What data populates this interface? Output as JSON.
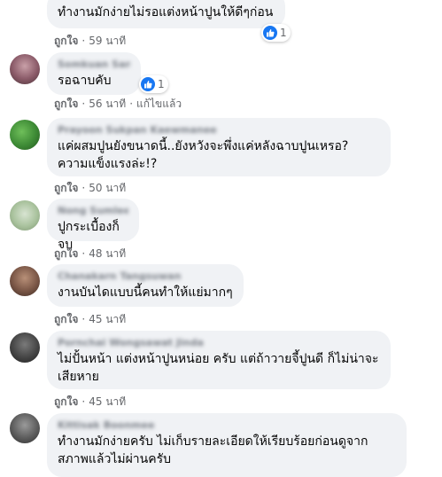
{
  "colors": {
    "like_blue": "#1877f2",
    "bubble_bg": "#f0f2f5",
    "meta_text": "#65676b"
  },
  "actions": {
    "like": "ถูกใจ",
    "dot": "·",
    "edited": "แก้ไขแล้ว"
  },
  "comments": [
    {
      "author": "",
      "text": "ทำงานมักง่ายไม่รอแต่งหน้าปูนให้ดีๆก่อน",
      "time": "59 นาที",
      "reactions": "1"
    },
    {
      "author": "Somkuan Sangkhawet",
      "text": "รอฉาบคับ",
      "time": "56 นาที",
      "reactions": "1"
    },
    {
      "author": "Prayoon Sukpan Kaewmanee",
      "text": "แค่ผสมปูนยังขนาดนี้..ยังหวังจะพึ่งแค่หลังฉาบปูนเหรอ? ความแข็งแรงล่ะ!?",
      "time": "50 นาที"
    },
    {
      "author": "Nong Sumlee",
      "text": "ปูกระเบื้องก็จบ",
      "time": "48 นาที"
    },
    {
      "author": "Chanakarn Tangsuwan",
      "text": "งานบันไดแบบนี้คนทำให้แย่มากๆ",
      "time": "45 นาที"
    },
    {
      "author": "Pornchai Wongsawat Jinda",
      "text": "ไม่ปั้นหน้า แต่งหน้าปูนหน่อย ครับ แต่ถ้าวายจี้ปูนดี ก็ไม่น่าจะเสียหาย",
      "time": "45 นาที"
    },
    {
      "author": "Kittisak Boonmee",
      "text": "ทำงานมักง่ายครับ ไม่เก็บรายละเอียดให้เรียบร้อยก่อนดูจากสภาพแล้วไม่ผ่านครับ",
      "time": ""
    }
  ]
}
